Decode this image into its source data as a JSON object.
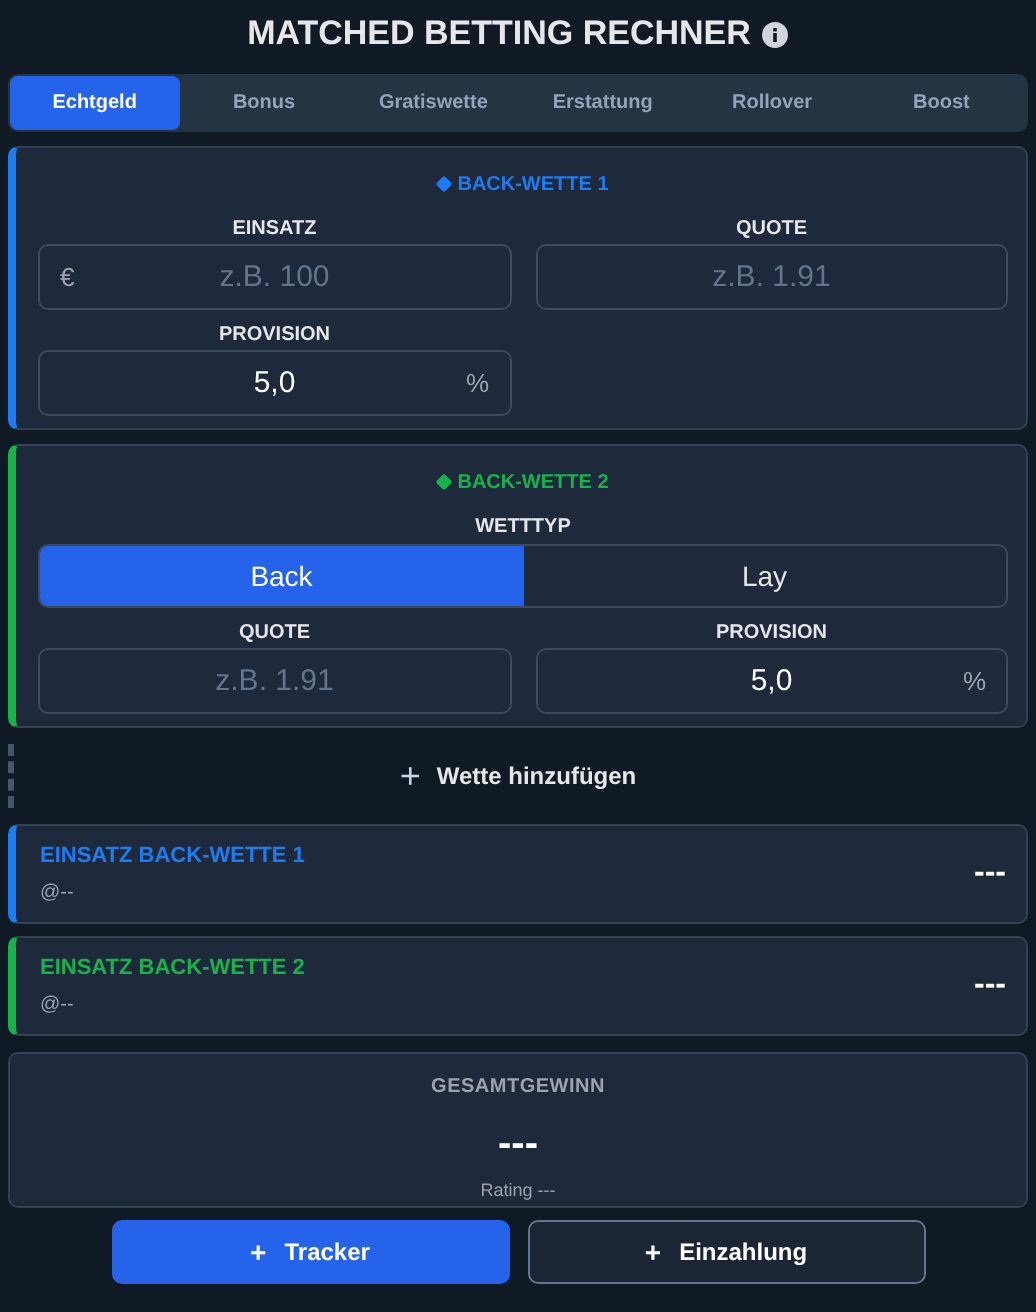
{
  "title": "MATCHED BETTING RECHNER",
  "tabs": [
    {
      "label": "Echtgeld",
      "selected": true
    },
    {
      "label": "Bonus",
      "selected": false
    },
    {
      "label": "Gratiswette",
      "selected": false
    },
    {
      "label": "Erstattung",
      "selected": false
    },
    {
      "label": "Rollover",
      "selected": false
    },
    {
      "label": "Boost",
      "selected": false
    }
  ],
  "bets": [
    {
      "title": "BACK-WETTE 1",
      "color": "#1d7cf2",
      "rows": [
        [
          {
            "label": "EINSATZ",
            "prefix": "€",
            "placeholder": "z.B. 100"
          },
          {
            "label": "QUOTE",
            "placeholder": "z.B. 1.91"
          }
        ],
        [
          {
            "label": "PROVISION",
            "value": "5,0",
            "suffix": "%"
          }
        ]
      ]
    },
    {
      "title": "BACK-WETTE 2",
      "color": "#16b34a",
      "bet_type": {
        "label": "WETTTYP",
        "options": [
          {
            "label": "Back",
            "selected": true
          },
          {
            "label": "Lay",
            "selected": false
          }
        ]
      },
      "rows": [
        [
          {
            "label": "QUOTE",
            "placeholder": "z.B. 1.91"
          },
          {
            "label": "PROVISION",
            "value": "5,0",
            "suffix": "%"
          }
        ]
      ]
    }
  ],
  "add_bet": {
    "icon": "+",
    "label": "Wette hinzufügen"
  },
  "results": [
    {
      "title": "EINSATZ BACK-WETTE 1",
      "color": "#1d7cf2",
      "odds": "@--",
      "value": "---"
    },
    {
      "title": "EINSATZ BACK-WETTE 2",
      "color": "#16b34a",
      "odds": "@--",
      "value": "---"
    }
  ],
  "total": {
    "label": "GESAMTGEWINN",
    "value": "---",
    "rating": "Rating ---"
  },
  "buttons": [
    {
      "icon": "+",
      "label": "Tracker",
      "kind": "primary"
    },
    {
      "icon": "+",
      "label": "Einzahlung",
      "kind": "outline"
    }
  ]
}
